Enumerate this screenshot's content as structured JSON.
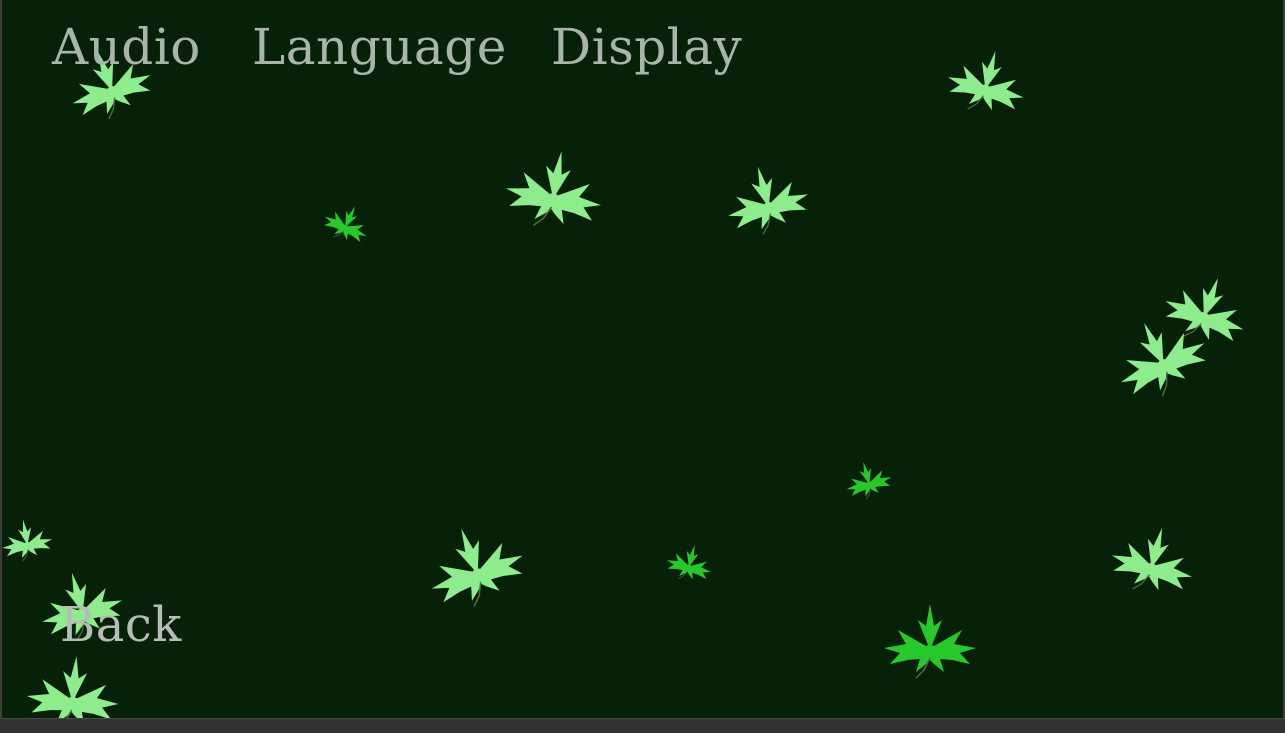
{
  "menu": {
    "tabs": [
      {
        "label": "Audio"
      },
      {
        "label": "Language"
      },
      {
        "label": "Display"
      }
    ],
    "back_label": "Back"
  },
  "colors": {
    "background": "#062108",
    "menu_text": "#a9b5ab",
    "leaf_light": "#8ded8c",
    "leaf_bright": "#27c92a",
    "leaf_stem": "#4f6a3a"
  },
  "decorations": {
    "leaf_icon": "maple-leaf"
  }
}
